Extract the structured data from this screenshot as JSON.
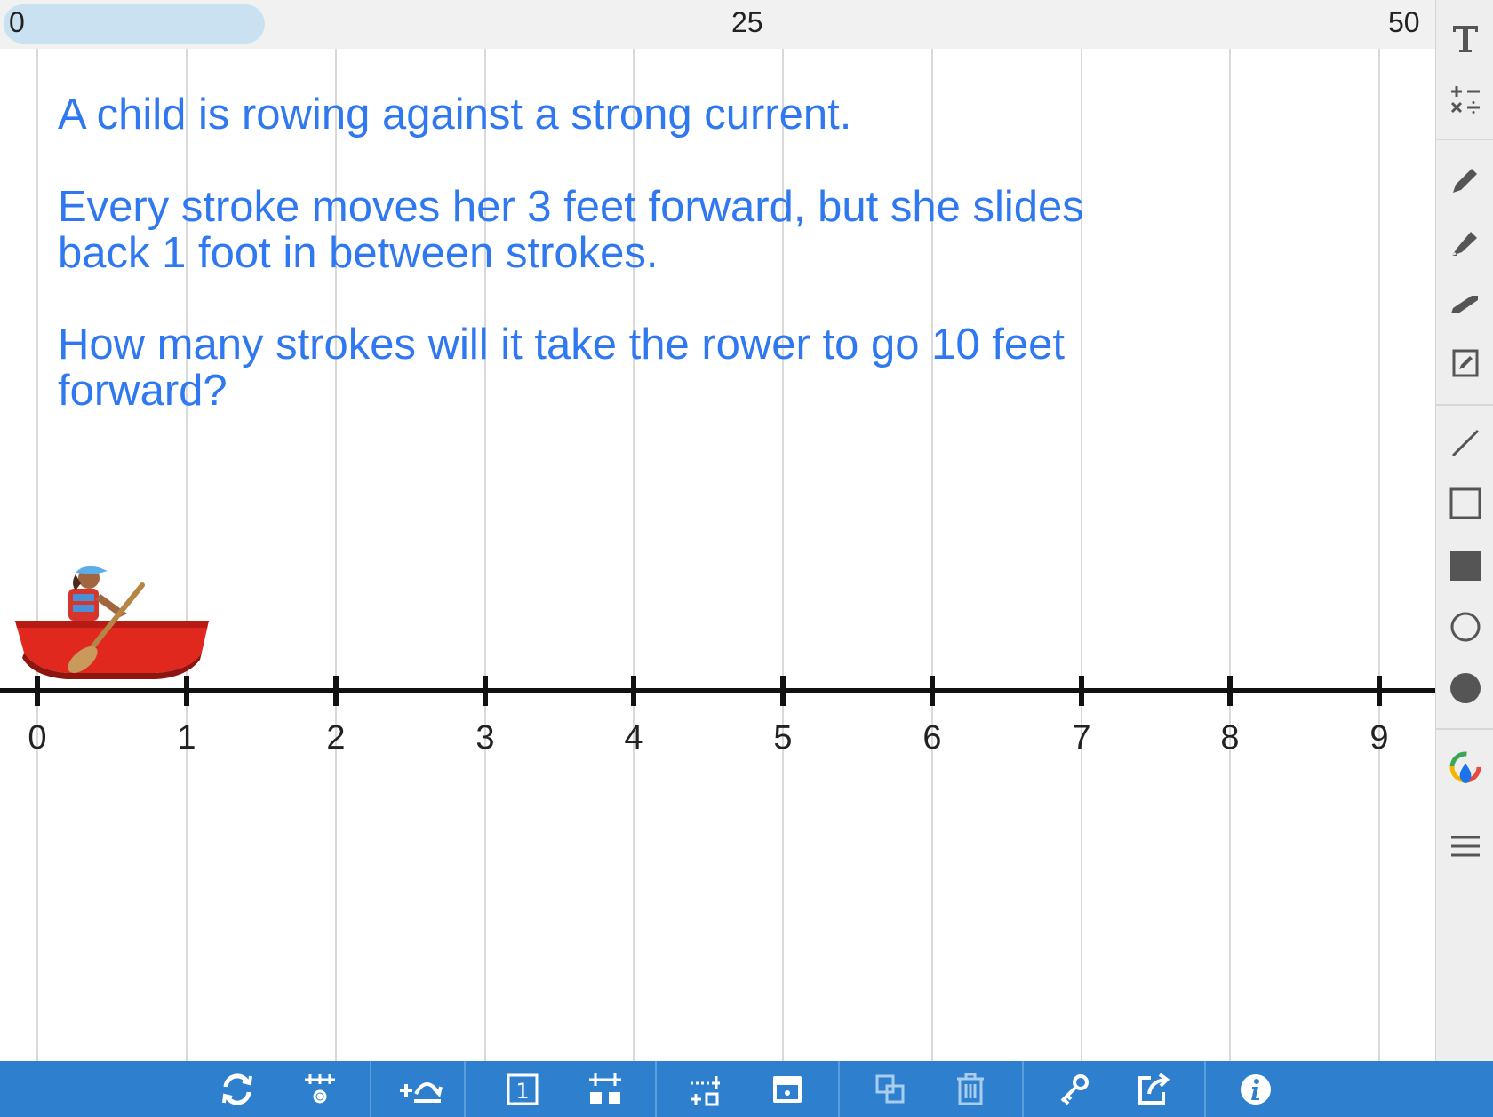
{
  "scrollbar": {
    "range_start": "0",
    "range_mid": "25",
    "range_end": "50"
  },
  "problem": {
    "line1": "A child is rowing against a strong current.",
    "line2": "Every stroke moves her 3 feet forward, but she slides back 1 foot in between strokes.",
    "line3": "How many strokes will it take the rower to go 10 feet forward?"
  },
  "number_line": {
    "labels": [
      "0",
      "1",
      "2",
      "3",
      "4",
      "5",
      "6",
      "7",
      "8",
      "9"
    ]
  },
  "colors": {
    "text_accent": "#2f78f0",
    "toolbar_bottom": "#2e80cf",
    "boat_red": "#e1281f"
  },
  "sidebar_icons": [
    "text-tool-icon",
    "math-symbols-icon",
    "pencil-icon",
    "marker-icon",
    "highlighter-icon",
    "edit-note-icon",
    "line-tool-icon",
    "rectangle-outline-icon",
    "rectangle-filled-icon",
    "circle-outline-icon",
    "circle-filled-icon",
    "color-picker-icon",
    "menu-icon"
  ],
  "bottom_icons": [
    "refresh-icon",
    "settings-icon",
    "add-jump-icon",
    "number-box-icon",
    "tick-marks-icon",
    "add-line-icon",
    "hide-icon",
    "duplicate-icon",
    "trash-icon",
    "key-icon",
    "share-icon",
    "info-icon"
  ]
}
